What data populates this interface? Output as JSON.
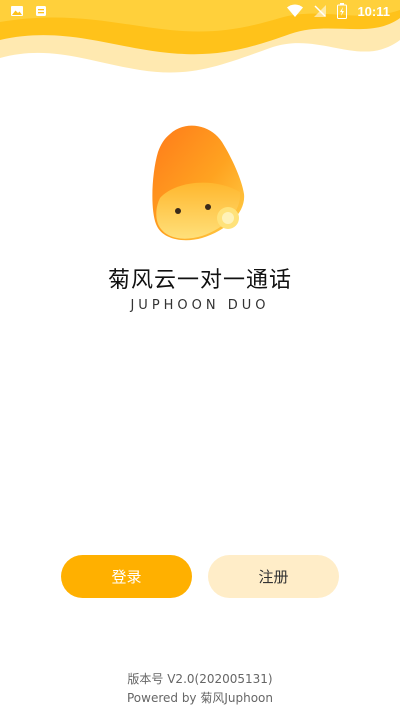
{
  "status_bar": {
    "time": "10:11",
    "left_icons": [
      "image-icon",
      "notification-icon"
    ],
    "right_icons": [
      "wifi-icon",
      "signal-icon",
      "battery-icon"
    ]
  },
  "app": {
    "logo": "juphoon-duo-logo",
    "title": "菊风云一对一通话",
    "subtitle": "JUPHOON DUO"
  },
  "buttons": {
    "login_label": "登录",
    "register_label": "注册"
  },
  "footer": {
    "version": "版本号 V2.0(202005131)",
    "powered_by": "Powered by 菊风Juphoon"
  },
  "colors": {
    "accent": "#FFB000",
    "accent_light": "#FFEDC8",
    "wave_primary": "#FFC21A",
    "wave_secondary": "#FFE9B0"
  }
}
